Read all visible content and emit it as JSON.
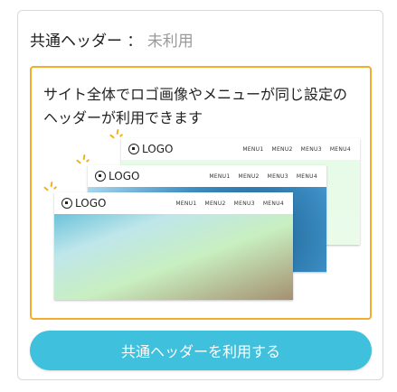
{
  "header": {
    "label": "共通ヘッダー",
    "separator": "：",
    "value": "未利用"
  },
  "info": {
    "description": "サイト全体でロゴ画像やメニューが同じ設定のヘッダーが利用できます"
  },
  "preview": {
    "logo_text": "LOGO",
    "menus": [
      "MENU1",
      "MENU2",
      "MENU3",
      "MENU4"
    ]
  },
  "action": {
    "button_label": "共通ヘッダーを利用する"
  },
  "colors": {
    "accent": "#3fc0dc",
    "highlight_border": "#f2ae2b"
  }
}
